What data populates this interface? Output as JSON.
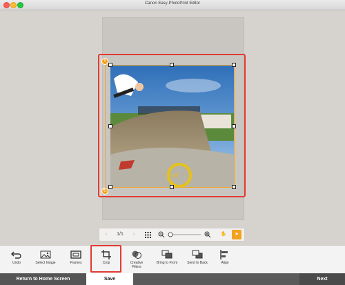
{
  "window": {
    "title": "Canon Easy-PhotoPrint Editor"
  },
  "navigation": {
    "page_indicator": "1/1"
  },
  "toolbar": {
    "items": [
      {
        "label": "Undo",
        "icon": "undo-icon"
      },
      {
        "label": "Select Image",
        "icon": "select-image-icon"
      },
      {
        "label": "Frames",
        "icon": "frames-icon"
      },
      {
        "label": "Crop",
        "icon": "crop-icon"
      },
      {
        "label": "Creative\nFilters",
        "icon": "creative-filters-icon"
      },
      {
        "label": "Bring to Front",
        "icon": "bring-to-front-icon"
      },
      {
        "label": "Send to Back",
        "icon": "send-to-back-icon"
      },
      {
        "label": "Align",
        "icon": "align-icon"
      }
    ]
  },
  "bottom_bar": {
    "home_label": "Return to Home Screen",
    "save_label": "Save",
    "next_label": "Next"
  },
  "colors": {
    "selection": "#e33a32",
    "accent": "#f3a21d"
  }
}
